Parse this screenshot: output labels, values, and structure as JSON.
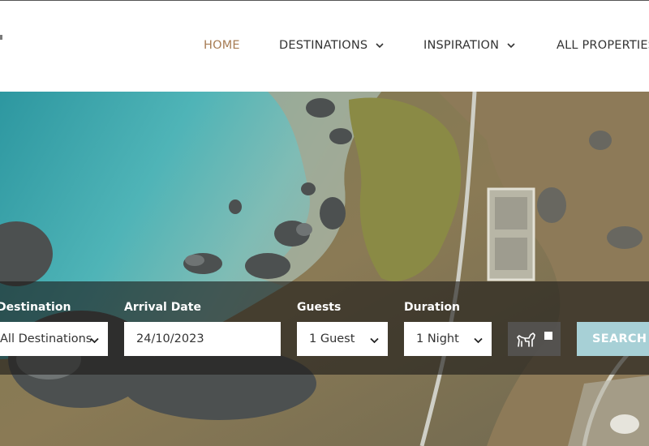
{
  "nav": {
    "items": [
      {
        "label": "HOME",
        "active": true,
        "has_dropdown": false
      },
      {
        "label": "DESTINATIONS",
        "active": false,
        "has_dropdown": true
      },
      {
        "label": "INSPIRATION",
        "active": false,
        "has_dropdown": true
      },
      {
        "label": "ALL PROPERTIES",
        "active": false,
        "has_dropdown": false
      }
    ]
  },
  "search": {
    "destination": {
      "label": "Destination",
      "value": "All Destinations"
    },
    "arrival": {
      "label": "Arrival Date",
      "value": "24/10/2023"
    },
    "guests": {
      "label": "Guests",
      "value": "1 Guest"
    },
    "duration": {
      "label": "Duration",
      "value": "1 Night"
    },
    "pet_filter": {
      "icon": "dog-icon",
      "checked": false
    },
    "button_label": "SEARCH"
  },
  "colors": {
    "nav_active": "#a77c54",
    "nav_text": "#333333",
    "search_button": "#a7d0d6",
    "search_bar_bg": "#1c1a18"
  }
}
